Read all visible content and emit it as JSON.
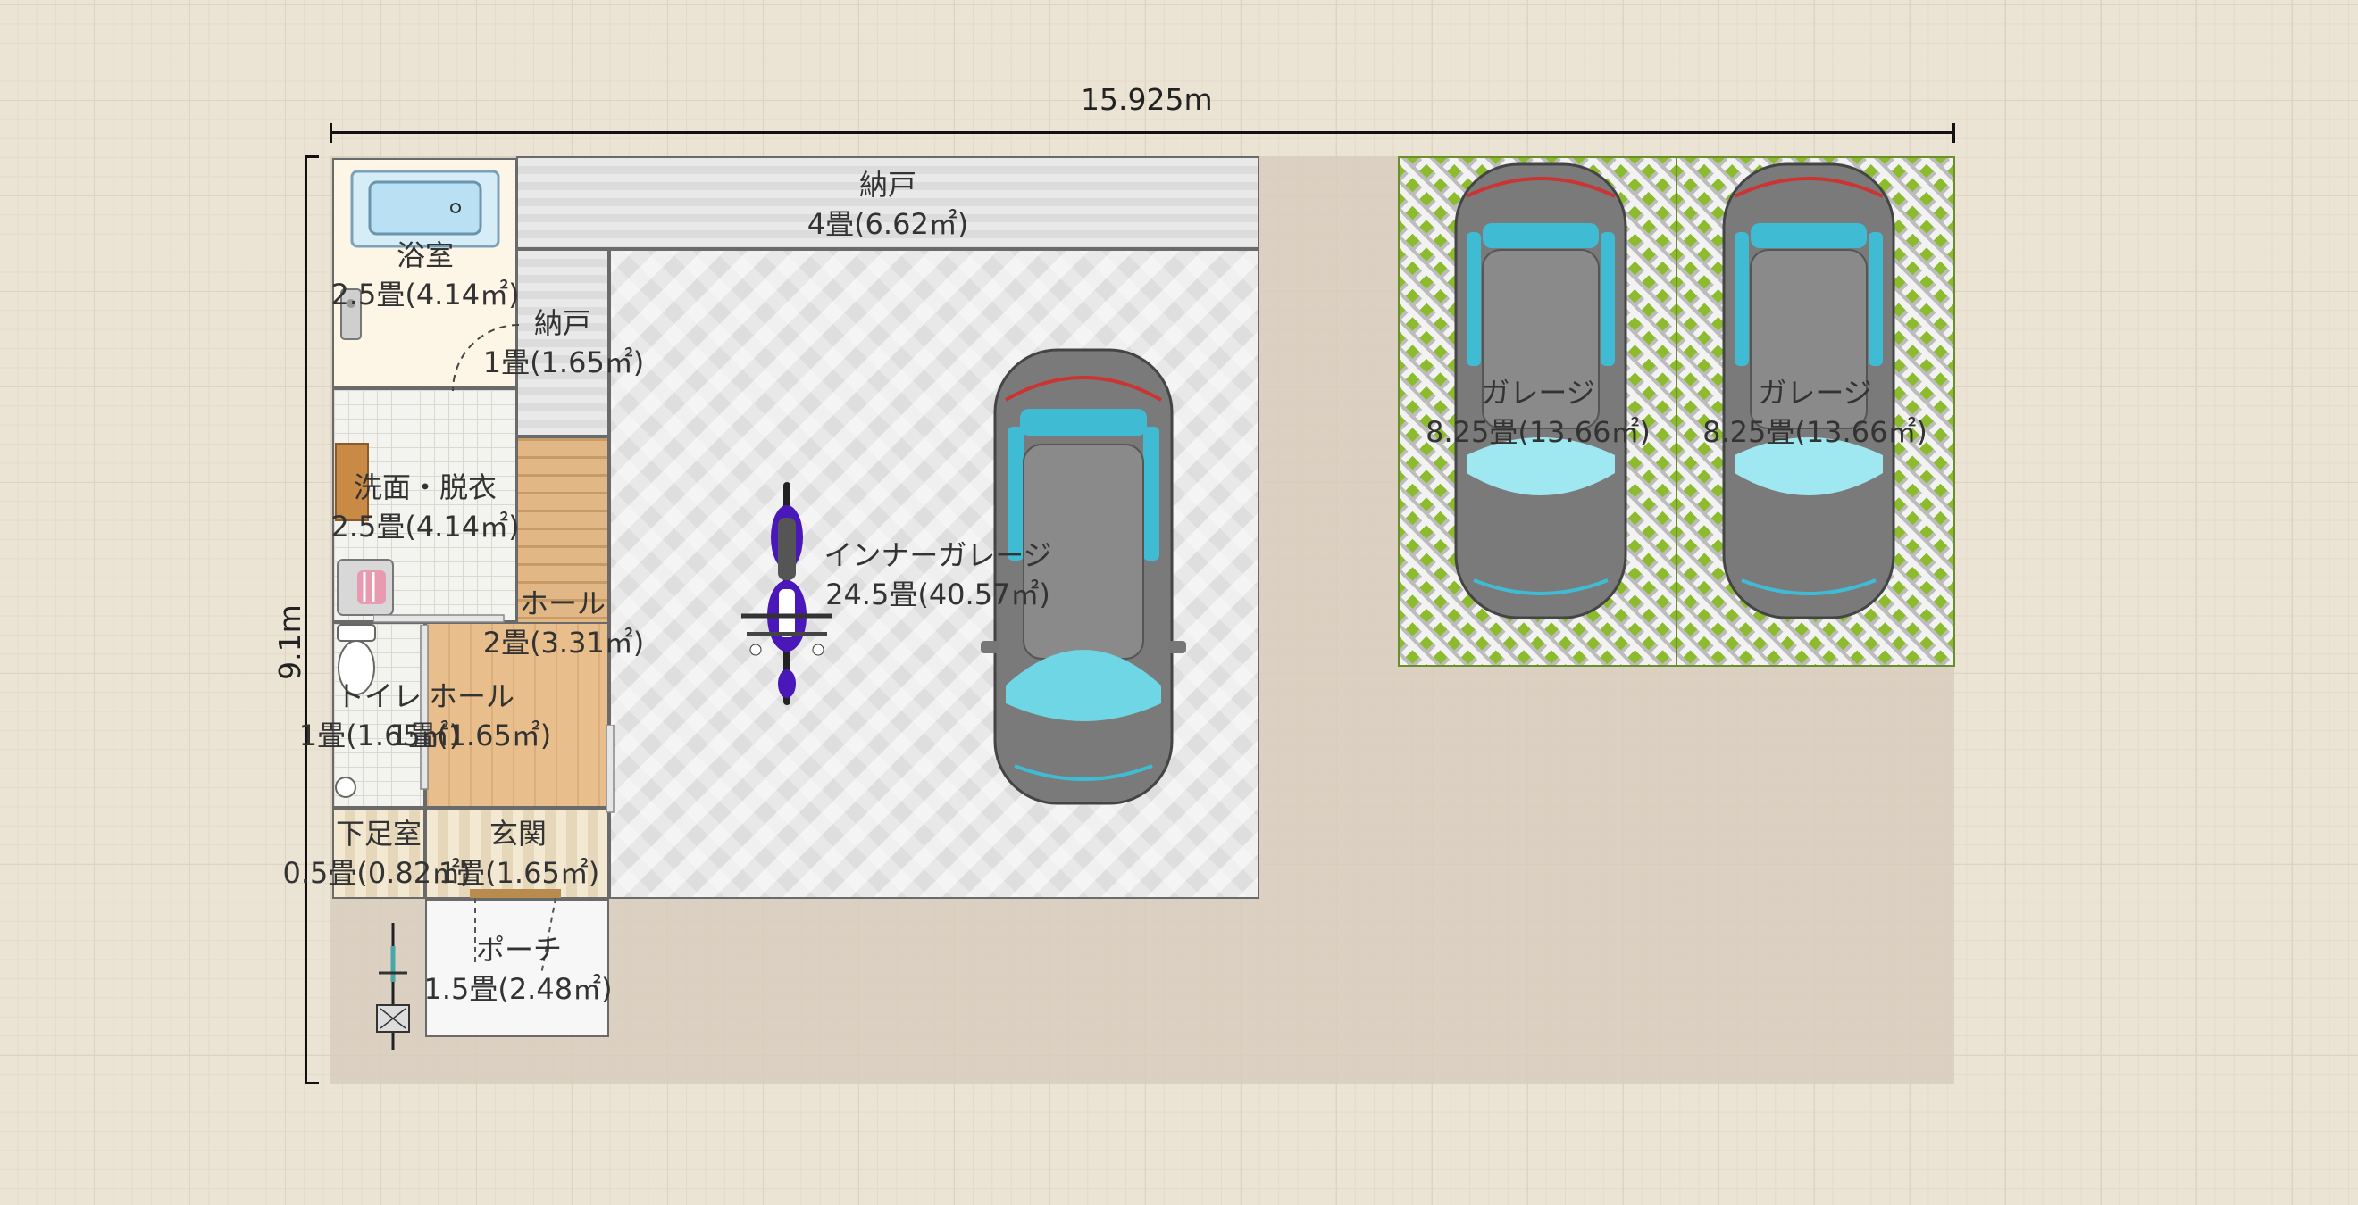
{
  "dimensions": {
    "width_label": "15.925m",
    "height_label": "9.1m"
  },
  "rooms": {
    "storage_top": {
      "name": "納戸",
      "area": "4畳(6.62㎡)"
    },
    "bath": {
      "name": "浴室",
      "area": "2.5畳(4.14㎡)"
    },
    "storage_small": {
      "name": "納戸",
      "area": "1畳(1.65㎡)"
    },
    "washroom": {
      "name": "洗面・脱衣",
      "area": "2.5畳(4.14㎡)"
    },
    "hall_upper": {
      "name": "ホール",
      "area": "2畳(3.31㎡)"
    },
    "toilet": {
      "name": "トイレ",
      "area": "1畳(1.65㎡)"
    },
    "hall_lower": {
      "name": "ホール",
      "area": "1畳(1.65㎡)"
    },
    "shoe_room": {
      "name": "下足室",
      "area": "0.5畳(0.82㎡)"
    },
    "entrance": {
      "name": "玄関",
      "area": "1畳(1.65㎡)"
    },
    "porch": {
      "name": "ポーチ",
      "area": "1.5畳(2.48㎡)"
    },
    "inner_garage": {
      "name": "インナーガレージ",
      "area": "24.5畳(40.57㎡)"
    },
    "garage_1": {
      "name": "ガレージ",
      "area": "8.25畳(13.66㎡)"
    },
    "garage_2": {
      "name": "ガレージ",
      "area": "8.25畳(13.66㎡)"
    }
  },
  "furniture": [
    "bathtub-icon",
    "sink-icon",
    "washing-machine-icon",
    "toilet-icon",
    "motorcycle-icon",
    "car-icon",
    "bicycle-icon"
  ],
  "colors": {
    "garage_green": "#8dbb2e",
    "car_glass": "#3fbcd4",
    "motorcycle": "#4a17b8"
  }
}
